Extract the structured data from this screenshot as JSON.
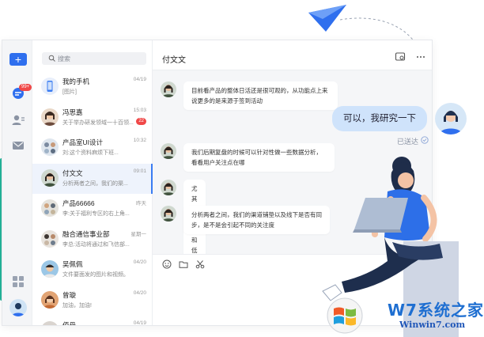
{
  "rail": {
    "add_label": "+",
    "badge": "99+"
  },
  "search": {
    "placeholder": "搜索"
  },
  "chats": [
    {
      "name": "我的手机",
      "preview": "[图片]",
      "time": "04/19",
      "badge": ""
    },
    {
      "name": "冯思嘉",
      "preview": "关于举办研发领域一十百领...",
      "time": "15:03",
      "badge": "22"
    },
    {
      "name": "产品室UI设计",
      "preview": "刘:这个资料麻烦下班...",
      "time": "10:32",
      "badge": ""
    },
    {
      "name": "付文文",
      "preview": "分析两者之间，我们的渠...",
      "time": "09:01",
      "badge": ""
    },
    {
      "name": "产品66666",
      "preview": "李:关于福利专区的右上角...",
      "time": "昨天",
      "badge": ""
    },
    {
      "name": "融合通信事业部",
      "preview": "李总:活动将通过和飞信部...",
      "time": "星期一",
      "badge": ""
    },
    {
      "name": "吴佩佩",
      "preview": "文件要面发的图片和视频。",
      "time": "04/20",
      "badge": ""
    },
    {
      "name": "曾璇",
      "preview": "加油，加油!",
      "time": "04/20",
      "badge": ""
    },
    {
      "name": "佰丹",
      "preview": "",
      "time": "04/19",
      "badge": ""
    }
  ],
  "conversation": {
    "title": "付文文",
    "messages": [
      "目前看产品的整体日活还是很可观的，从功能点上来说更多的是来源于签到活动",
      "我们后期复盘的时候可以针对性做一些数据分析，看看用户关注点在哪",
      "尤其是高值和低值",
      "分析两者之间，我们的渠道铺垫以及线下是否有同步，是不是会引起不同的关注度"
    ],
    "outgoing": "可以，我研究一下",
    "outgoing_status": "已送达"
  },
  "watermark": {
    "brand": "W7系统之家",
    "url": "Winwin7.com"
  },
  "colors": {
    "accent": "#2f6fee",
    "badge": "#f04848",
    "outgoing_bubble": "#cfe3fb"
  }
}
